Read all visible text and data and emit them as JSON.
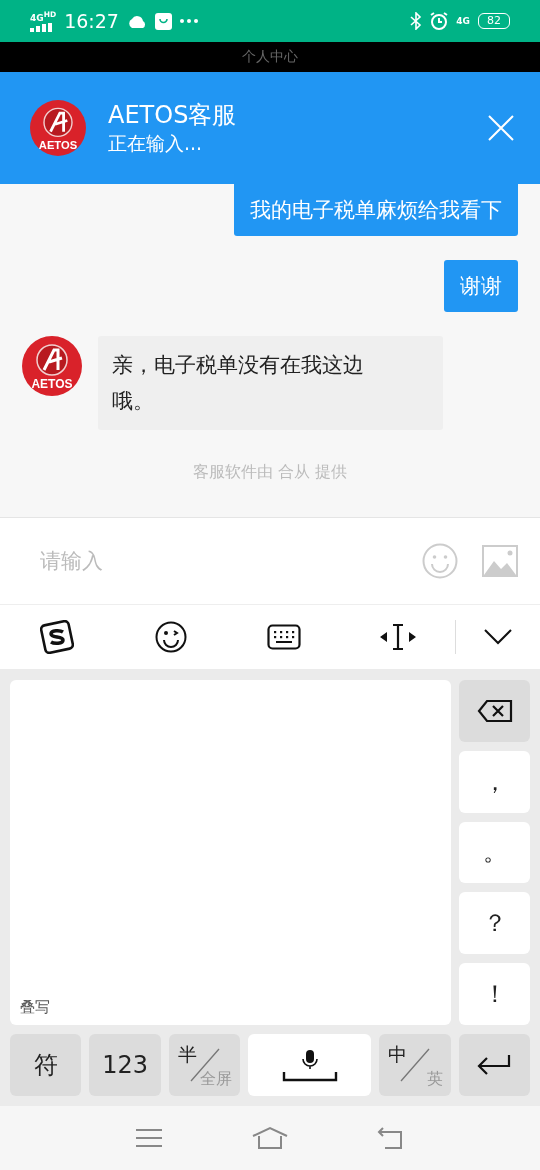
{
  "status_bar": {
    "network": "4G",
    "network_badge": "HD",
    "time": "16:27",
    "cell": "4G",
    "battery": "82"
  },
  "background_title": "个人中心",
  "header": {
    "name": "AETOS客服",
    "status": "正在输入...",
    "logo_text": "AETOS"
  },
  "messages": [
    {
      "kind": "sent",
      "text": "我的电子税单麻烦给我看下"
    },
    {
      "kind": "sent",
      "text": "谢谢"
    },
    {
      "kind": "received",
      "text": "亲，电子税单没有在我这边哦。",
      "logo_text": "AETOS"
    }
  ],
  "footer_note": "客服软件由 合从 提供",
  "composer": {
    "placeholder": "请输入"
  },
  "keyboard": {
    "handwriting_label": "叠写",
    "punctuation": [
      "，",
      "。",
      "？",
      "！"
    ],
    "bottom_keys": [
      {
        "kind": "text",
        "label": "符"
      },
      {
        "kind": "text",
        "label": "123"
      },
      {
        "kind": "split",
        "top": "半",
        "bottom": "全屏"
      },
      {
        "kind": "space"
      },
      {
        "kind": "split",
        "top": "中",
        "bottom": "英"
      },
      {
        "kind": "enter"
      }
    ]
  }
}
